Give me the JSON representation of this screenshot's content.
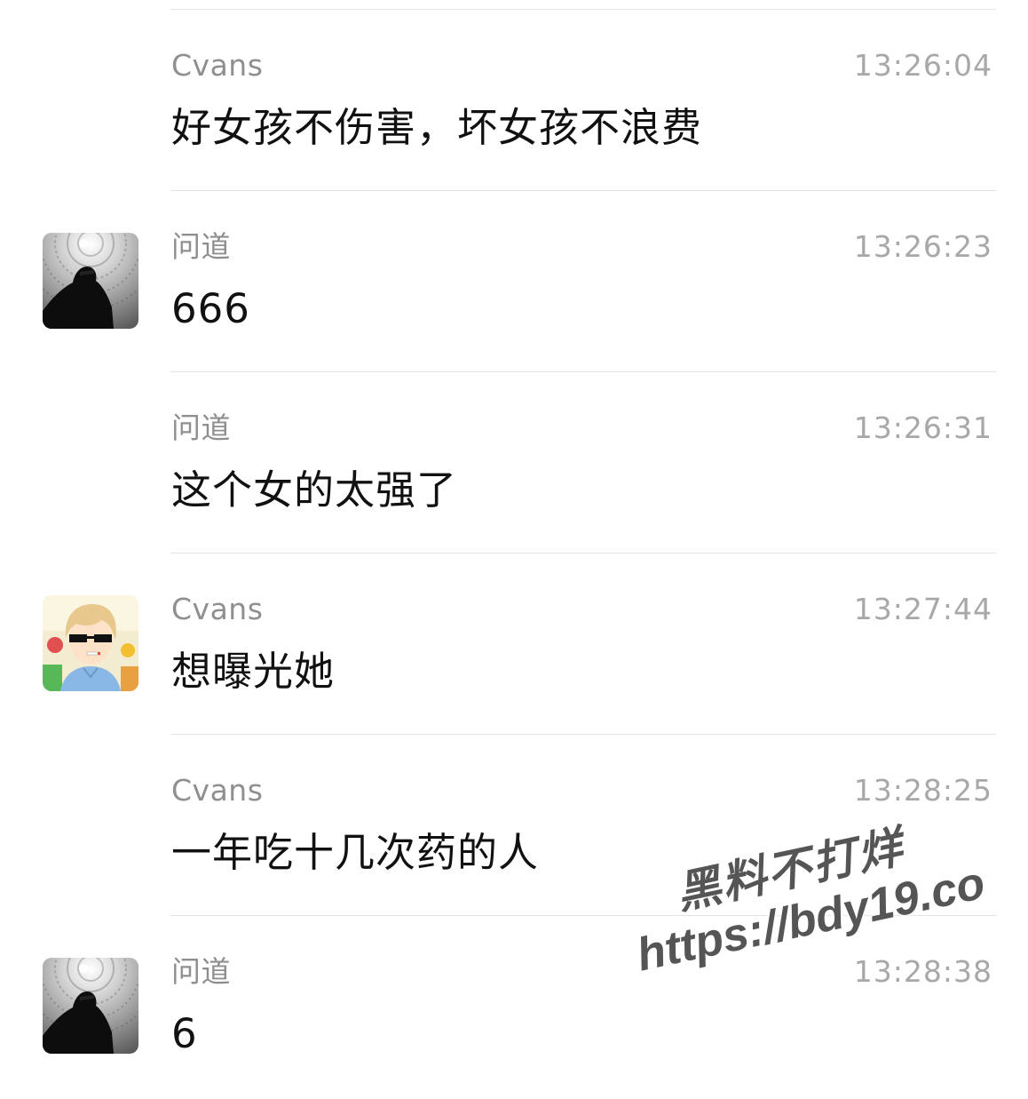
{
  "messages": [
    {
      "sender": "Cvans",
      "time": "13:26:04",
      "text": "好女孩不伤害，坏女孩不浪费",
      "avatar": null
    },
    {
      "sender": "问道",
      "time": "13:26:23",
      "text": "666",
      "avatar": "wendao-avatar"
    },
    {
      "sender": "问道",
      "time": "13:26:31",
      "text": "这个女的太强了",
      "avatar": null
    },
    {
      "sender": "Cvans",
      "time": "13:27:44",
      "text": "想曝光她",
      "avatar": "cvans-avatar"
    },
    {
      "sender": "Cvans",
      "time": "13:28:25",
      "text": "一年吃十几次药的人",
      "avatar": null
    },
    {
      "sender": "问道",
      "time": "13:28:38",
      "text": "6",
      "avatar": "wendao-avatar"
    }
  ],
  "watermark": {
    "line1": "黑料不打烊",
    "line2": "https://bdy19.co"
  },
  "colors": {
    "sender": "#8f8f8f",
    "time": "#a8a8a8",
    "text": "#111111",
    "divider": "#e3e3e3",
    "background": "#ffffff"
  }
}
